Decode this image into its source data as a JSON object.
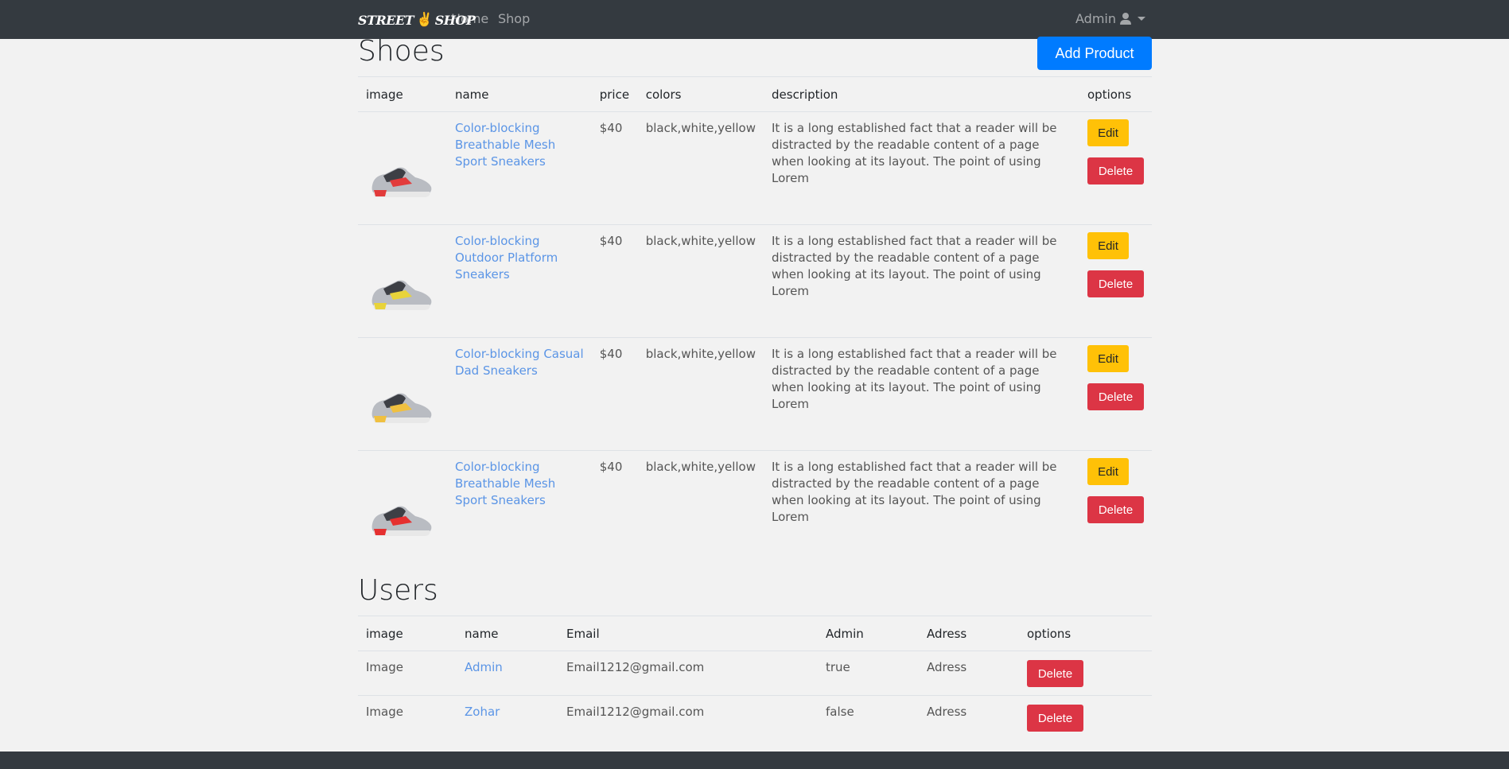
{
  "navbar": {
    "brand_left": "STREET",
    "brand_right": "SHOP",
    "home": "Home",
    "shop": "Shop",
    "user": "Admin"
  },
  "shoes": {
    "title": "Shoes",
    "add_label": "Add Product",
    "headers": [
      "image",
      "name",
      "price",
      "colors",
      "description",
      "options"
    ],
    "products": [
      {
        "name": "Color-blocking Breathable Mesh Sport Sneakers",
        "price": "$40",
        "colors": "black,white,yellow",
        "description": "It is a long established fact that a reader will be distracted by the readable content of a page when looking at its layout. The point of using Lorem",
        "accent": "#e23b3b"
      },
      {
        "name": "Color-blocking Outdoor Platform Sneakers",
        "price": "$40",
        "colors": "black,white,yellow",
        "description": "It is a long established fact that a reader will be distracted by the readable content of a page when looking at its layout. The point of using Lorem",
        "accent": "#e8d33a"
      },
      {
        "name": "Color-blocking Casual Dad Sneakers",
        "price": "$40",
        "colors": "black,white,yellow",
        "description": "It is a long established fact that a reader will be distracted by the readable content of a page when looking at its layout. The point of using Lorem",
        "accent": "#f0c040"
      },
      {
        "name": "Color-blocking Breathable Mesh Sport Sneakers",
        "price": "$40",
        "colors": "black,white,yellow",
        "description": "It is a long established fact that a reader will be distracted by the readable content of a page when looking at its layout. The point of using Lorem",
        "accent": "#e53030"
      }
    ],
    "edit_label": "Edit",
    "delete_label": "Delete"
  },
  "users": {
    "title": "Users",
    "headers": [
      "image",
      "name",
      "Email",
      "Admin",
      "Adress",
      "options"
    ],
    "rows": [
      {
        "image": "Image",
        "name": "Admin",
        "email": "Email1212@gmail.com",
        "admin": "true",
        "address": "Adress"
      },
      {
        "image": "Image",
        "name": "Zohar",
        "email": "Email1212@gmail.com",
        "admin": "false",
        "address": "Adress"
      }
    ],
    "delete_label": "Delete"
  },
  "colors": {
    "navbar": "#343a40",
    "primary": "#007bff",
    "warning": "#ffc107",
    "danger": "#dc3545",
    "link": "#5b95e6"
  }
}
